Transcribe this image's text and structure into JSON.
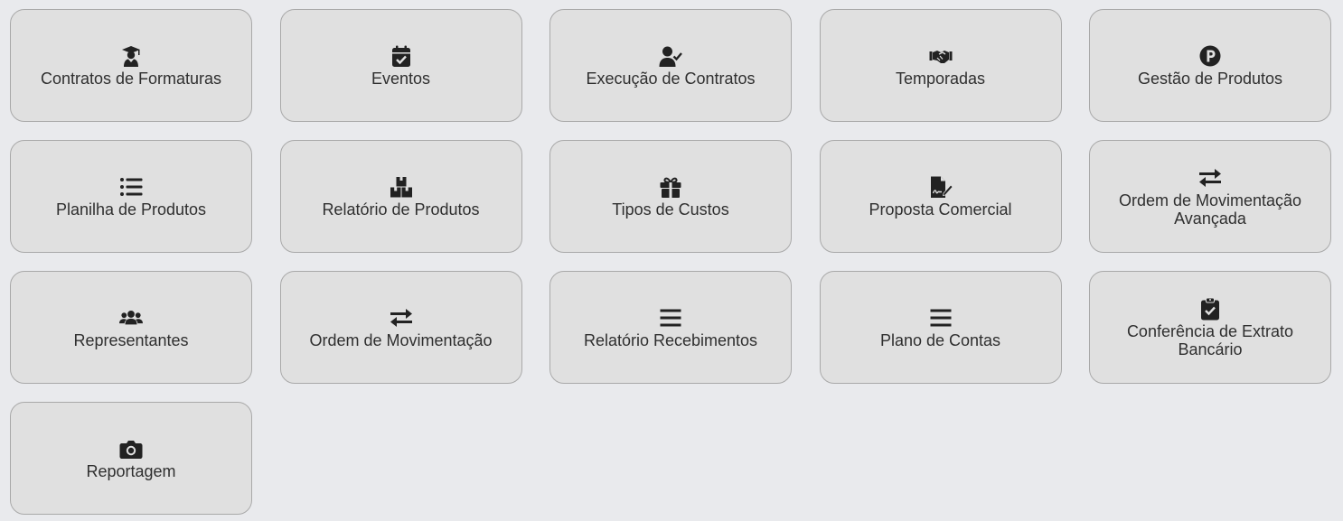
{
  "tiles": [
    {
      "label": "Contratos de Formaturas",
      "icon": "graduate-icon"
    },
    {
      "label": "Eventos",
      "icon": "calendar-check-icon"
    },
    {
      "label": "Execução de Contratos",
      "icon": "user-check-icon"
    },
    {
      "label": "Temporadas",
      "icon": "handshake-icon"
    },
    {
      "label": "Gestão de Produtos",
      "icon": "product-p-icon"
    },
    {
      "label": "Planilha de Produtos",
      "icon": "list-icon"
    },
    {
      "label": "Relatório de Produtos",
      "icon": "boxes-icon"
    },
    {
      "label": "Tipos de Custos",
      "icon": "gift-icon"
    },
    {
      "label": "Proposta Comercial",
      "icon": "file-signature-icon"
    },
    {
      "label": "Ordem de Movimentação Avançada",
      "icon": "exchange-icon"
    },
    {
      "label": "Representantes",
      "icon": "users-icon"
    },
    {
      "label": "Ordem de Movimentação",
      "icon": "exchange-icon"
    },
    {
      "label": "Relatório Recebimentos",
      "icon": "bars-icon"
    },
    {
      "label": "Plano de Contas",
      "icon": "bars-icon"
    },
    {
      "label": "Conferência de Extrato Bancário",
      "icon": "clipboard-check-icon"
    },
    {
      "label": "Reportagem",
      "icon": "camera-icon"
    }
  ],
  "colors": {
    "background": "#e9eaed",
    "tile": "#e0e0e0",
    "tile_border": "#a9a9a9",
    "text": "#2f2f2f",
    "icon": "#222222"
  }
}
